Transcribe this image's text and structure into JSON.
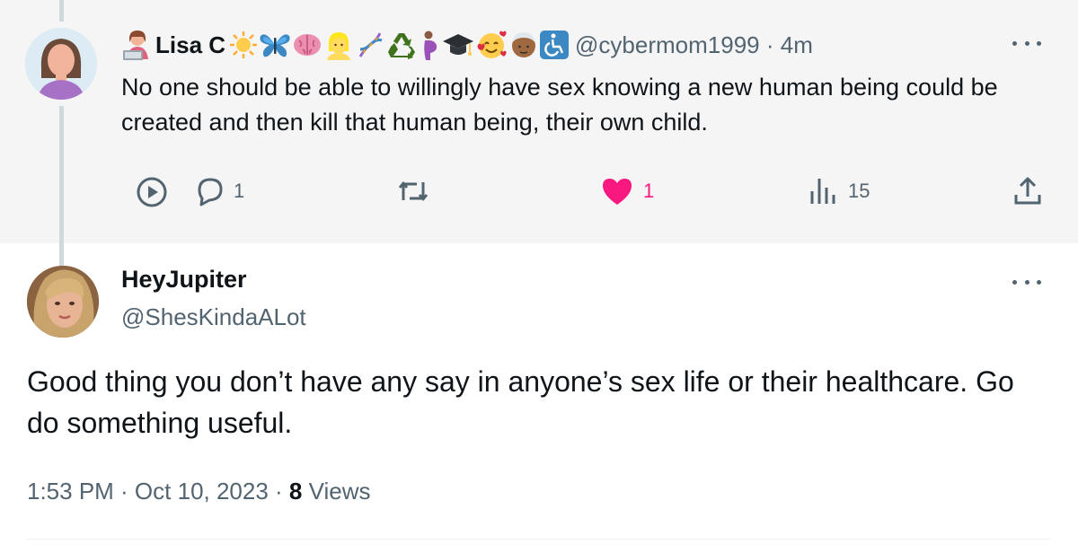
{
  "parent_tweet": {
    "display_name": "Lisa C",
    "name_emojis": [
      "technologist-emoji",
      "sun-emoji",
      "butterfly-emoji",
      "brain-emoji",
      "blond-person-emoji",
      "dna-emoji",
      "recycle-emoji",
      "pregnant-person-emoji",
      "graduation-cap-emoji",
      "smiling-hearts-emoji",
      "older-person-emoji",
      "wheelchair-symbol-emoji"
    ],
    "handle": "@cybermom1999",
    "time": "· 4m",
    "text": "No one should be able to willingly have sex knowing a new human being could be created and then kill that human being, their own child.",
    "replies": "1",
    "likes": "1",
    "views": "15"
  },
  "reply_tweet": {
    "display_name": "HeyJupiter",
    "handle": "@ShesKindaALot",
    "text": "Good thing you don’t have any say in anyone’s sex life or their healthcare. Go do something useful.",
    "time": "1:53 PM · Oct 10, 2023 · ",
    "views_count": "8",
    "views_label": " Views"
  },
  "colors": {
    "parent_bg": "#f5f5f5",
    "secondary_text": "#536471",
    "like_pink": "#f91880",
    "thread_line": "#cfd9de"
  }
}
